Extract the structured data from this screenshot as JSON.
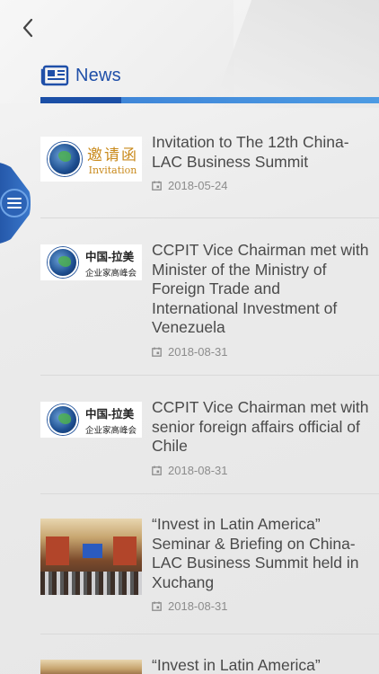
{
  "header": {
    "title": "News",
    "back_icon": "chevron-left-icon",
    "title_icon": "newspaper-icon",
    "accent_colors": [
      "#1b4fa6",
      "#4d9be3"
    ]
  },
  "side_menu": {
    "icon": "menu-icon",
    "color": "#1f4fa0"
  },
  "news": [
    {
      "headline": "Invitation to The 12th China-LAC Business Summit",
      "date": "2018-05-24",
      "thumb": {
        "type": "invitation",
        "cn": "邀请函",
        "en": "Invitation"
      }
    },
    {
      "headline": "CCPIT Vice Chairman met with Minister of the Ministry of Foreign Trade and International Investment of Venezuela",
      "date": "2018-08-31",
      "thumb": {
        "type": "logo",
        "cn1": "中国-拉美",
        "cn2": "企业家高峰会"
      }
    },
    {
      "headline": "CCPIT Vice Chairman met with senior foreign affairs official of Chile",
      "date": "2018-08-31",
      "thumb": {
        "type": "logo",
        "cn1": "中国-拉美",
        "cn2": "企业家高峰会"
      }
    },
    {
      "headline": "“Invest in Latin America” Seminar & Briefing on China-LAC Business Summit held in Xuchang",
      "date": "2018-08-31",
      "thumb": {
        "type": "photo"
      }
    },
    {
      "headline": "“Invest in Latin America”",
      "thumb": {
        "type": "photo"
      }
    }
  ]
}
